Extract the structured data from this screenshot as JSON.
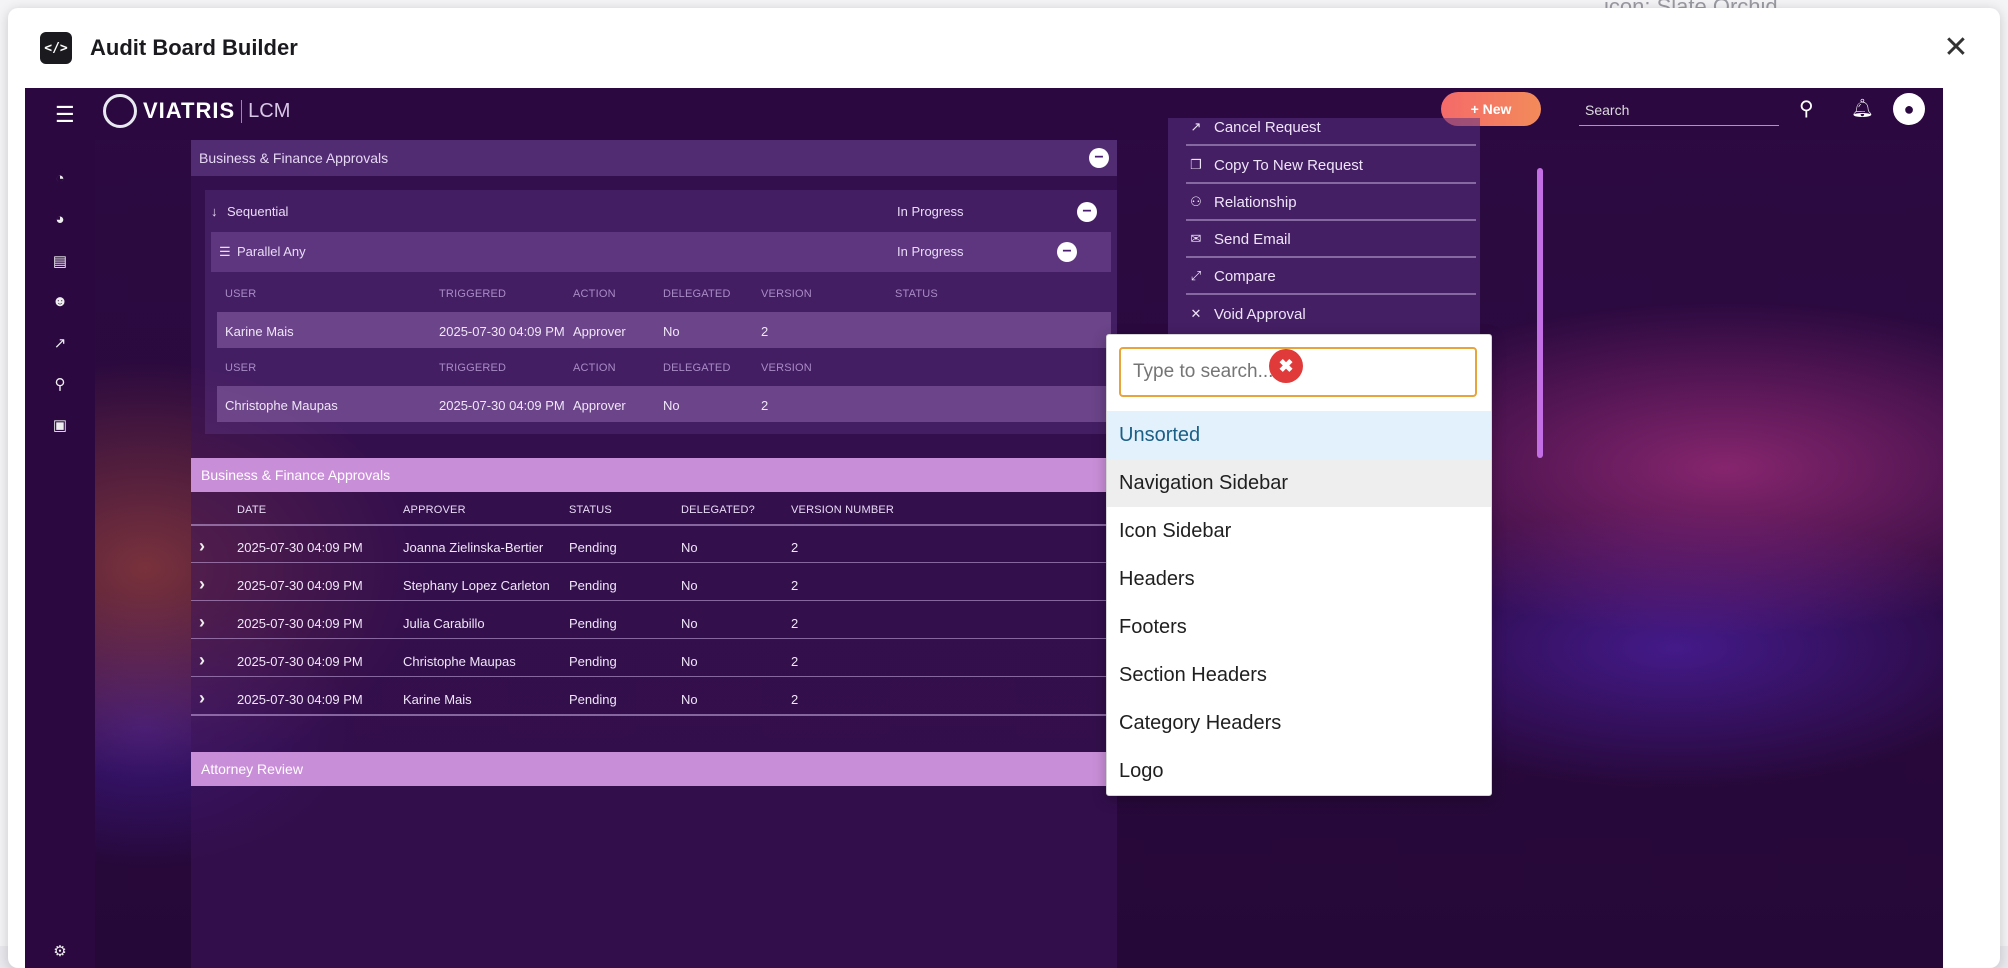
{
  "background": {
    "text": "icon: Slate Orchid"
  },
  "modal": {
    "title": "Audit Board Builder",
    "close_label": "✕",
    "icon_glyph": "</>"
  },
  "app": {
    "logo": {
      "brand": "VIATRIS",
      "product": "LCM"
    },
    "topbar": {
      "new_button": "+ New",
      "search_placeholder": "Search"
    },
    "sections": {
      "business_finance": "Business & Finance Approvals",
      "sequential": "Sequential",
      "parallel_any": "Parallel Any",
      "in_progress": "In Progress",
      "attorney_review": "Attorney Review"
    },
    "parallel_table": {
      "headers": [
        "USER",
        "TRIGGERED",
        "ACTION",
        "DELEGATED",
        "VERSION",
        "STATUS"
      ],
      "rows": [
        {
          "user": "Karine Mais",
          "triggered": "2025-07-30 04:09 PM",
          "action": "Approver",
          "delegated": "No",
          "version": "2"
        },
        {
          "user": "Christophe Maupas",
          "triggered": "2025-07-30 04:09 PM",
          "action": "Approver",
          "delegated": "No",
          "version": "2"
        }
      ]
    },
    "approvals_table": {
      "title": "Business & Finance Approvals",
      "headers": [
        "DATE",
        "APPROVER",
        "STATUS",
        "DELEGATED?",
        "VERSION NUMBER"
      ],
      "rows": [
        {
          "date": "2025-07-30 04:09 PM",
          "approver": "Joanna Zielinska-Bertier",
          "status": "Pending",
          "delegated": "No",
          "version": "2"
        },
        {
          "date": "2025-07-30 04:09 PM",
          "approver": "Stephany Lopez Carleton",
          "status": "Pending",
          "delegated": "No",
          "version": "2"
        },
        {
          "date": "2025-07-30 04:09 PM",
          "approver": "Julia Carabillo",
          "status": "Pending",
          "delegated": "No",
          "version": "2"
        },
        {
          "date": "2025-07-30 04:09 PM",
          "approver": "Christophe Maupas",
          "status": "Pending",
          "delegated": "No",
          "version": "2"
        },
        {
          "date": "2025-07-30 04:09 PM",
          "approver": "Karine Mais",
          "status": "Pending",
          "delegated": "No",
          "version": "2"
        }
      ]
    },
    "actions": [
      {
        "label": "Cancel Request",
        "icon": "cancel-icon"
      },
      {
        "label": "Copy To New Request",
        "icon": "copy-icon"
      },
      {
        "label": "Relationship",
        "icon": "relationship-icon"
      },
      {
        "label": "Send Email",
        "icon": "email-icon"
      },
      {
        "label": "Compare",
        "icon": "compare-icon"
      },
      {
        "label": "Void Approval",
        "icon": "void-icon"
      }
    ]
  },
  "dropdown": {
    "search_placeholder": "Type to search...",
    "options": [
      "Unsorted",
      "Navigation Sidebar",
      "Icon Sidebar",
      "Headers",
      "Footers",
      "Section Headers",
      "Category Headers",
      "Logo"
    ],
    "selected": "Unsorted",
    "hovered": "Navigation Sidebar"
  },
  "colors": {
    "accent": "#e8a33a",
    "app_bg": "#2a0a3e",
    "pink_bar": "#c98ed8",
    "selected_bg": "#e2f1fb",
    "clear_button": "#e03a3a"
  }
}
